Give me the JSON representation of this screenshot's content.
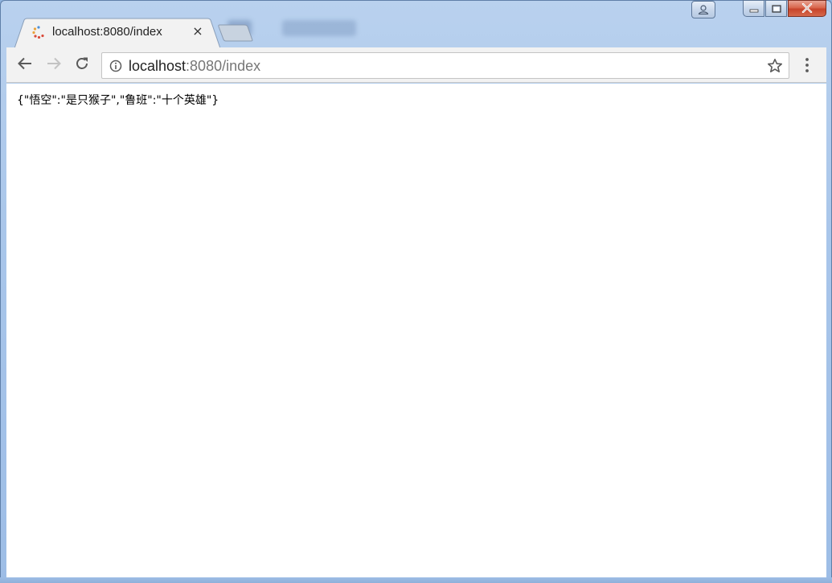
{
  "tab": {
    "title": "localhost:8080/index",
    "close_label": "×"
  },
  "omnibox": {
    "host": "localhost",
    "rest": ":8080/index"
  },
  "content": {
    "json_text": "{\"悟空\":\"是只猴子\",\"鲁班\":\"十个英雄\"}"
  },
  "icons": {
    "back": "back-arrow-icon",
    "forward": "forward-arrow-icon",
    "reload": "reload-icon",
    "info": "info-icon",
    "star": "star-icon",
    "menu": "kebab-menu-icon",
    "profile": "person-icon",
    "minimize": "minimize-icon",
    "maximize": "maximize-icon",
    "close": "close-icon",
    "favicon": "loading-spinner-icon"
  },
  "colors": {
    "frame": "#a9c6ea",
    "toolbar": "#f2f2f2",
    "close_button": "#c7442b"
  }
}
